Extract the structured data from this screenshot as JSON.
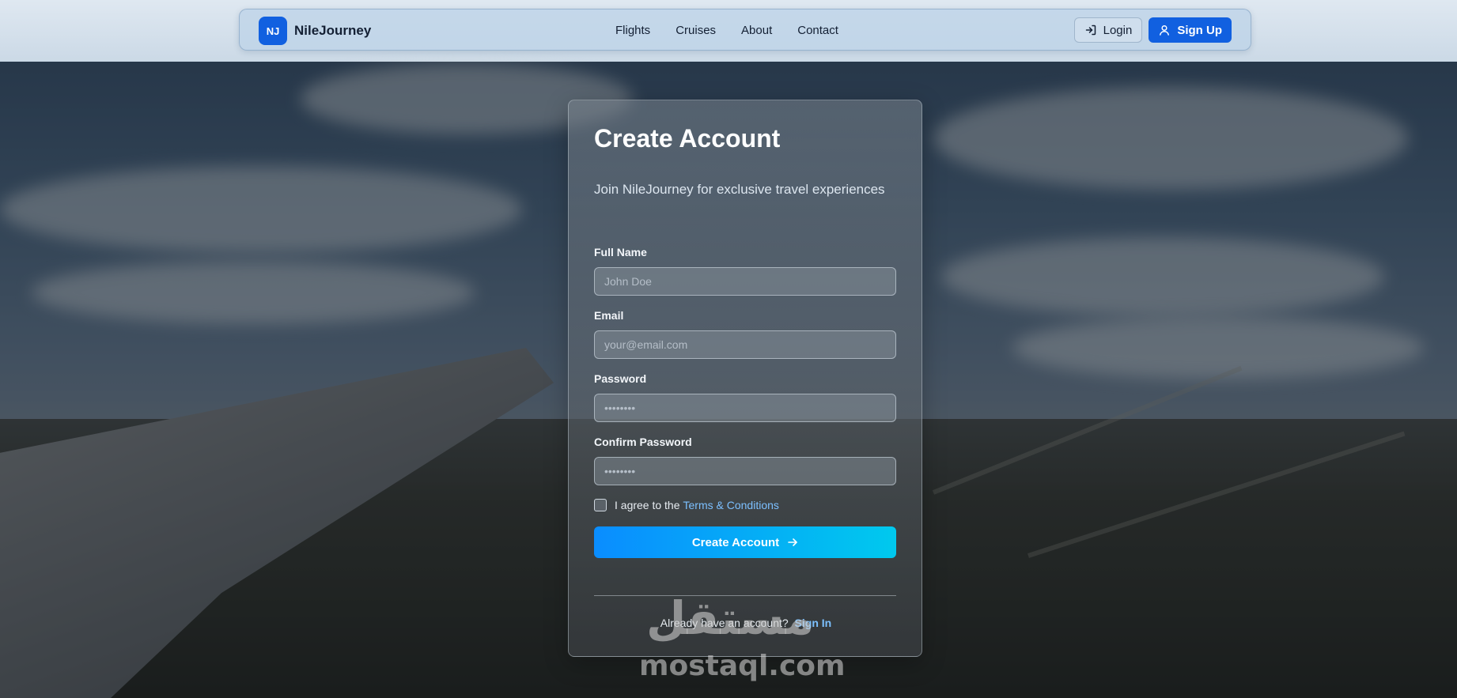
{
  "navbar": {
    "logo_initials": "NJ",
    "brand_name": "NileJourney",
    "links": [
      "Flights",
      "Cruises",
      "About",
      "Contact"
    ],
    "login_label": "Login",
    "signup_label": "Sign Up"
  },
  "form": {
    "title": "Create Account",
    "subtitle": "Join NileJourney for exclusive travel experiences",
    "fields": [
      {
        "label": "Full Name",
        "placeholder": "John Doe",
        "type": "text"
      },
      {
        "label": "Email",
        "placeholder": "your@email.com",
        "type": "email"
      },
      {
        "label": "Password",
        "placeholder": "••••••••",
        "type": "password"
      },
      {
        "label": "Confirm Password",
        "placeholder": "••••••••",
        "type": "password"
      }
    ],
    "agree_text": "I agree to the",
    "terms_link": "Terms & Conditions",
    "submit_label": "Create Account",
    "signin_prompt": "Already have an account?",
    "signin_link": "Sign In"
  },
  "watermark": {
    "arabic": "مستقل",
    "latin": "mostaql.com"
  },
  "colors": {
    "primary": "#1160e0",
    "gradient_start": "#0a8dff",
    "gradient_end": "#00c9ee",
    "link": "#7cc0ff"
  },
  "icons": {
    "login": "login-icon",
    "signup": "user-icon",
    "submit": "arrow-right-icon"
  }
}
